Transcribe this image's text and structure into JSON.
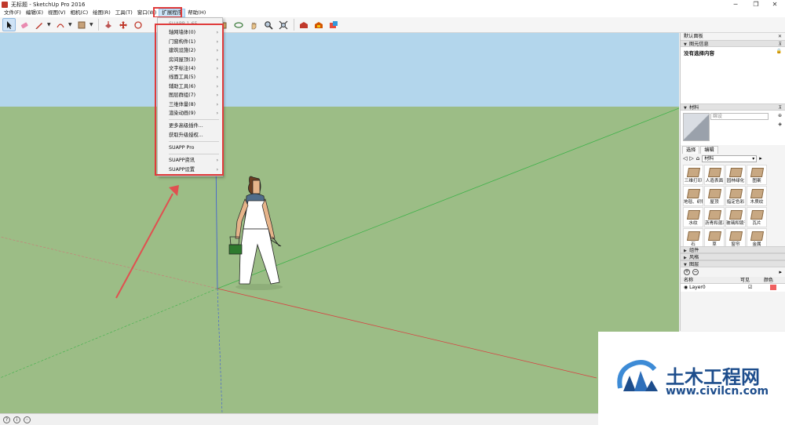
{
  "window": {
    "title": "无标题 - SketchUp Pro 2016",
    "controls": {
      "minimize": "─",
      "maximize": "❐",
      "close": "✕"
    }
  },
  "menubar": {
    "items": [
      {
        "label": "文件(F)"
      },
      {
        "label": "编辑(E)"
      },
      {
        "label": "视图(V)"
      },
      {
        "label": "相机(C)"
      },
      {
        "label": "绘图(R)"
      },
      {
        "label": "工具(T)"
      },
      {
        "label": "窗口(W)"
      },
      {
        "label": "扩展程序",
        "active": true
      },
      {
        "label": "帮助(H)"
      }
    ]
  },
  "toolbar": {
    "tools": [
      "select-icon",
      "eraser-icon",
      "pencil-icon",
      "arc-icon",
      "shape-icon",
      "push-pull-icon",
      "move-icon",
      "rotate-icon",
      "scale-icon",
      "orbit-icon",
      "pan-icon",
      "zoom-icon",
      "zoom-extents-icon",
      "warehouse-icon",
      "extension-warehouse-icon",
      "layout-icon"
    ]
  },
  "extension_menu": {
    "header": "SUAPP 1.65",
    "items": [
      {
        "label": "轴网墙体(0)",
        "submenu": true
      },
      {
        "label": "门窗构件(1)",
        "submenu": true
      },
      {
        "label": "建筑设施(2)",
        "submenu": true
      },
      {
        "label": "房间屋顶(3)",
        "submenu": true
      },
      {
        "label": "文字标注(4)",
        "submenu": true
      },
      {
        "label": "线面工具(5)",
        "submenu": true
      },
      {
        "label": "辅助工具(6)",
        "submenu": true
      },
      {
        "label": "图层群组(7)",
        "submenu": true
      },
      {
        "label": "三维体量(8)",
        "submenu": true
      },
      {
        "label": "渲染动画(9)",
        "submenu": true
      }
    ],
    "group2": [
      {
        "label": "更多高级插件..."
      },
      {
        "label": "获取升级授权..."
      }
    ],
    "group3": [
      {
        "label": "SUAPP Pro"
      }
    ],
    "group4": [
      {
        "label": "SUAPP资讯",
        "submenu": true
      },
      {
        "label": "SUAPP设置",
        "submenu": true
      }
    ]
  },
  "tray": {
    "title": "默认面板",
    "entity_info": {
      "header": "图元信息",
      "content": "没有选择内容"
    },
    "materials": {
      "header": "材料",
      "name_placeholder": "绵设",
      "tabs": [
        "选择",
        "编辑"
      ],
      "collection": "材料",
      "items": [
        "三维打印",
        "人造表面",
        "园林绿化",
        "图案",
        "地毯、织物",
        "屋顶",
        "指定色彩",
        "木质纹",
        "水纹",
        "沥青和混凝土",
        "玻璃和镜子",
        "瓦片",
        "石",
        "草",
        "窗帘",
        "金属"
      ]
    },
    "collapsed_sections": [
      "组件",
      "风格"
    ],
    "layers": {
      "header": "图层",
      "columns": [
        "名称",
        "可见",
        "颜色"
      ],
      "rows": [
        {
          "name": "Layer0",
          "visible": "☑",
          "color": "#f06060"
        }
      ]
    }
  },
  "watermark": {
    "title": "土木工程网",
    "url": "www.civilcn.com"
  },
  "colors": {
    "sky": "#b3d6ec",
    "ground": "#9cbd86",
    "highlight": "#e03b3b",
    "menu_active": "#cce4f7"
  }
}
